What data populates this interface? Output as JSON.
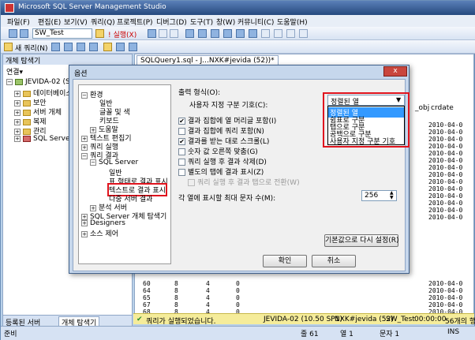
{
  "app_title": "Microsoft SQL Server Management Studio",
  "menu": [
    "파일(F)",
    "편집(E)",
    "보기(V)",
    "쿼리(Q)",
    "프로젝트(P)",
    "디버그(D)",
    "도구(T)",
    "창(W)",
    "커뮤니티(C)",
    "도움말(H)"
  ],
  "toolbar": {
    "database": "SW_Test",
    "execute": "! 실행(X)",
    "new_query": "새 쿼리(N)"
  },
  "explorer": {
    "title": "개체 탐색기",
    "connect": "연결▾",
    "items": [
      "JEVIDA-02 (SQL",
      "데이터베이스",
      "보안",
      "서버 개체",
      "복제",
      "관리",
      "SQL Server A"
    ],
    "bottom_tabs": [
      "등록된 서버",
      "개체 탐색기"
    ]
  },
  "editor": {
    "tab_label": "SQLQuery1.sql - J...NXK#jevida (52))*",
    "col_obj": "_obj",
    "col_crdate": "crdate",
    "dates": [
      "2010-04-0",
      "2010-04-0",
      "2010-04-0",
      "2010-04-0",
      "2010-04-0",
      "2010-04-0",
      "2010-04-0",
      "2010-04-0",
      "2010-04-0",
      "2010-04-0",
      "2010-04-0",
      "2010-04-0",
      "2010-04-0",
      "2010-04-0"
    ],
    "rows": [
      {
        "a": "60",
        "b": "8",
        "c": "4",
        "d": "0"
      },
      {
        "a": "64",
        "b": "8",
        "c": "4",
        "d": "0"
      },
      {
        "a": "65",
        "b": "8",
        "c": "4",
        "d": "0"
      },
      {
        "a": "67",
        "b": "8",
        "c": "4",
        "d": "0"
      },
      {
        "a": "68",
        "b": "8",
        "c": "4",
        "d": "0"
      }
    ],
    "right_dates": [
      "2010-04-0",
      "2010-04-0",
      "2010-04-0",
      "2010-04-0",
      "2010-04-0"
    ]
  },
  "query_status": {
    "message": "쿼리가 실행되었습니다.",
    "server": "JEVIDA-02 (10.50 SP1)",
    "user": "NXK#jevida (52)",
    "db": "SW_Test",
    "time": "00:00:00",
    "rows": "56개의 행"
  },
  "app_status": {
    "ready": "준비",
    "line": "줄 61",
    "col": "열 1",
    "char": "문자 1",
    "mode": "INS"
  },
  "dialog": {
    "title": "옵션",
    "close": "x",
    "tree": [
      "환경",
      "일반",
      "글꼴 및 색",
      "키보드",
      "도움말",
      "텍스트 편집기",
      "쿼리 실행",
      "쿼리 결과",
      "SQL Server",
      "일반",
      "표 형태로 결과 표시",
      "텍스트로 결과 표시",
      "다중 서버 결과",
      "분석 서버",
      "SQL Server 개체 탐색기",
      "Designers",
      "소스 제어"
    ],
    "output_format_label": "출력 형식(O):",
    "custom_delim_label": "사용자 지정 구분 기호(C):",
    "output_format_value": "정렬된 열",
    "output_format_options": [
      "정렬된 열",
      "쉼표로 구분",
      "탭으로 구분",
      "공백으로 구분",
      "사용자 지정 구분 기호"
    ],
    "checkboxes": [
      {
        "label": "결과 집합에 열 머리글 포함(I)",
        "checked": true
      },
      {
        "label": "결과 집합에 쿼리 포함(N)",
        "checked": false
      },
      {
        "label": "결과를 받는 대로 스크롤(L)",
        "checked": true
      },
      {
        "label": "숫자 값 오른쪽 맞춤(G)",
        "checked": false
      },
      {
        "label": "쿼리 실행 후 결과 삭제(D)",
        "checked": false
      },
      {
        "label": "별도의 탭에 결과 표시(Z)",
        "checked": false
      },
      {
        "label": "쿼리 실행 후 결과 탭으로 전환(W)",
        "checked": false
      }
    ],
    "max_chars_label": "각 열에 표시할 최대 문자 수(M):",
    "max_chars_value": "256",
    "reset_button": "기본값으로 다시 설정(R)",
    "ok_button": "확인",
    "cancel_button": "취소"
  }
}
